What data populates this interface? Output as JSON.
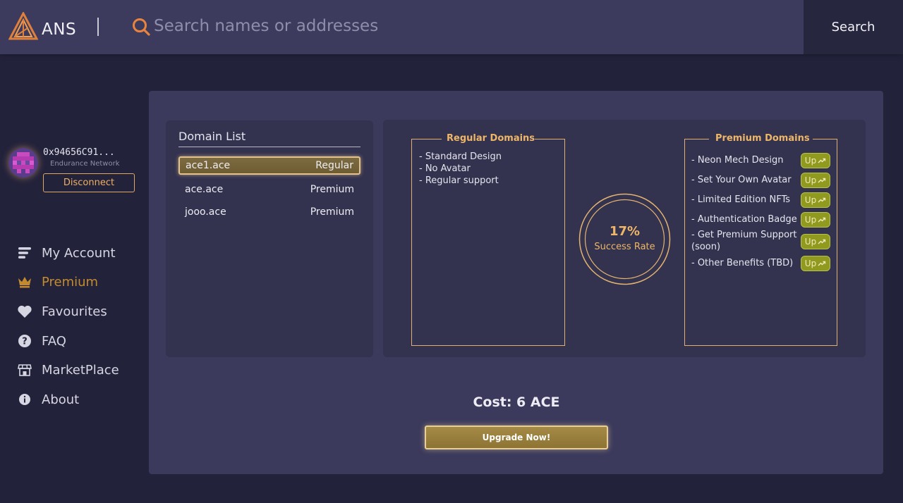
{
  "header": {
    "logo_text": "ANS",
    "search_placeholder": "Search names or addresses",
    "search_button": "Search"
  },
  "account": {
    "address": "0x94656C91...",
    "network": "Endurance Network",
    "disconnect_label": "Disconnect"
  },
  "nav": {
    "items": [
      {
        "label": "My Account",
        "icon": "menu-lines-icon"
      },
      {
        "label": "Premium",
        "icon": "crown-icon",
        "active": true
      },
      {
        "label": "Favourites",
        "icon": "heart-icon"
      },
      {
        "label": "FAQ",
        "icon": "question-icon"
      },
      {
        "label": "MarketPlace",
        "icon": "store-icon"
      },
      {
        "label": "About",
        "icon": "info-icon"
      }
    ]
  },
  "domain_list": {
    "title": "Domain List",
    "rows": [
      {
        "name": "ace1.ace",
        "type": "Regular",
        "selected": true
      },
      {
        "name": "ace.ace",
        "type": "Premium"
      },
      {
        "name": "jooo.ace",
        "type": "Premium"
      }
    ]
  },
  "regular": {
    "title": "Regular Domains",
    "features": [
      "- Standard Design",
      "- No Avatar",
      "- Regular support"
    ]
  },
  "premium": {
    "title": "Premium Domains",
    "features": [
      "- Neon Mech Design",
      "- Set Your Own Avatar",
      "- Limited Edition NFTs",
      "- Authentication Badge",
      "- Get Premium Support (soon)",
      "- Other Benefits (TBD)"
    ],
    "badge_label": "Up"
  },
  "success": {
    "percent": "17%",
    "label": "Success Rate"
  },
  "cost": {
    "text": "Cost: 6 ACE",
    "button": "Upgrade Now!"
  },
  "colors": {
    "accent": "#eeb666",
    "active_nav": "#c48b2e",
    "badge": "#8f9a1e",
    "panel": "#3b3a5c",
    "background": "#23223b"
  }
}
